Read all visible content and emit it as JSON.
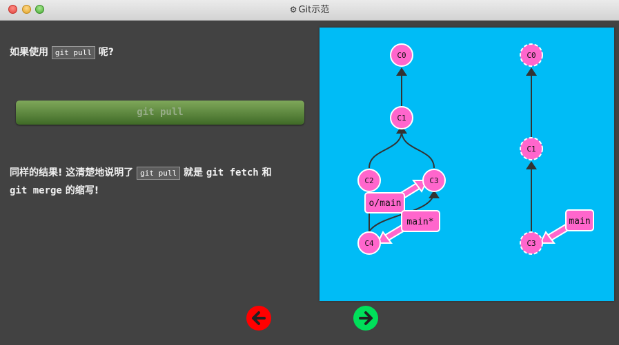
{
  "window": {
    "title": "Git示范"
  },
  "intro": {
    "before": "如果使用",
    "code": "git pull",
    "after": "呢?"
  },
  "command_button": {
    "label": "git pull"
  },
  "result": {
    "part1": "同样的结果! 这清楚地说明了",
    "code": "git pull",
    "part2": "就是",
    "kw1": "git fetch",
    "part3": "和",
    "kw2": "git merge",
    "part4": "的缩写!"
  },
  "graph_left": {
    "commits": [
      "C0",
      "C1",
      "C2",
      "C3",
      "C4"
    ],
    "labels": {
      "remote": "o/main",
      "local": "main*"
    }
  },
  "graph_right": {
    "commits": [
      "C0",
      "C1",
      "C3"
    ],
    "labels": {
      "local": "main"
    }
  },
  "colors": {
    "canvas": "#00bcf6",
    "commit": "#ff66cc",
    "branch": "#ff66cc",
    "prev": "#ff0000",
    "next": "#00e05a"
  },
  "nav": {
    "prev_icon": "arrow-left-icon",
    "next_icon": "arrow-right-icon"
  }
}
